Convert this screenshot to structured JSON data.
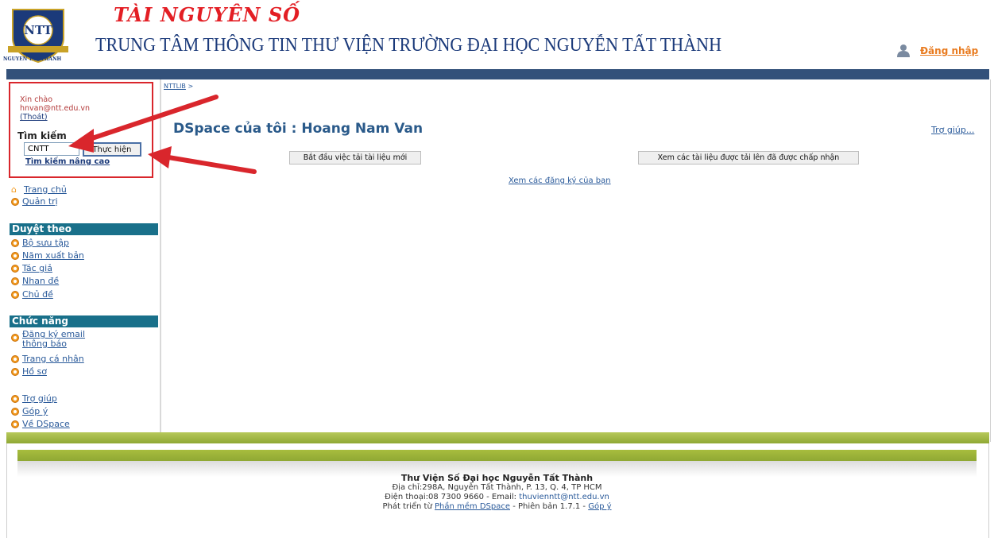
{
  "header": {
    "logo_text": "NGUYEN TAT THANH",
    "logo_monogram": "NTT",
    "brand": "TÀI NGUYÊN SỐ",
    "subtitle": "TRUNG TÂM THÔNG TIN THƯ VIỆN TRƯỜNG ĐẠI HỌC NGUYỄN TẤT THÀNH",
    "login_label": "Đăng nhập"
  },
  "sidebar": {
    "greeting": "Xin chào",
    "email": "hnvan@ntt.edu.vn",
    "logout": "(Thoát)",
    "search_title": "Tìm kiếm",
    "search_value": "CNTT",
    "search_button": "Thực hiện",
    "advanced_search": "Tìm kiếm nâng cao",
    "home": "Trang chủ",
    "admin": "Quản trị",
    "browse_title": "Duyệt theo",
    "browse": [
      "Bộ sưu tập",
      "Năm xuất bản",
      "Tác giả",
      "Nhan đề",
      "Chủ đề"
    ],
    "functions_title": "Chức năng",
    "functions": [
      "Đăng ký email",
      "thông báo",
      "Trang cá nhân",
      "Hồ sơ"
    ],
    "extra": [
      "Trợ giúp",
      "Góp ý",
      "Về DSpace"
    ]
  },
  "main": {
    "breadcrumb": "NTTLIB",
    "breadcrumb_sep": ">",
    "title": "DSpace của tôi : Hoang Nam Van",
    "help": "Trợ giúp...",
    "start_button": "Bắt đầu việc tải tài liệu mới",
    "accepted_button": "Xem các tài liệu được tải lên đã được chấp nhận",
    "subscriptions_link": "Xem các đăng ký của bạn"
  },
  "footer": {
    "title": "Thư Viện Số Đại học Nguyễn Tất Thành",
    "address": "Địa chỉ:298A, Nguyễn Tất Thành, P. 13, Q. 4, TP HCM",
    "phone_prefix": "Điện thoại:08 7300 9660 - Email:",
    "email": "thuvienntt@ntt.edu.vn",
    "dev_prefix": "Phát triển từ",
    "dspace_link": "Phần mềm DSpace",
    "version": "- Phiên bản 1.7.1 -",
    "feedback": "Góp ý"
  },
  "colors": {
    "brand_red": "#e31e24",
    "navy": "#1b3a7a",
    "nav_bar": "#33517a",
    "section": "#19708a",
    "green": "#8fa834",
    "orange": "#f39a1e",
    "annotation_red": "#d9262c"
  }
}
